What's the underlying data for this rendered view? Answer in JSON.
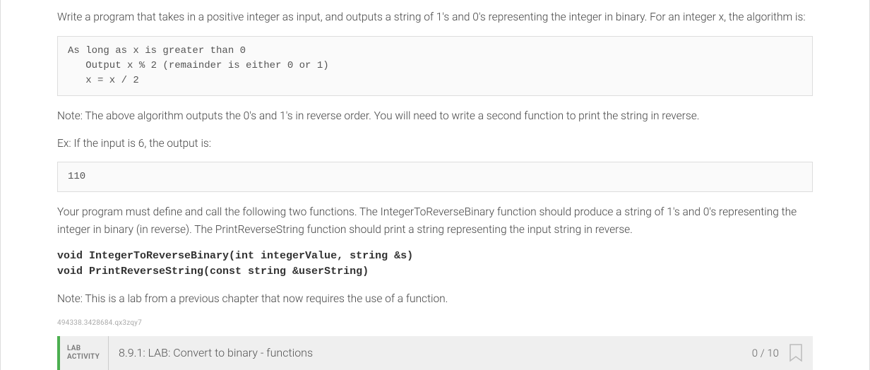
{
  "intro": "Write a program that takes in a positive integer as input, and outputs a string of 1's and 0's representing the integer in binary. For an integer x, the algorithm is:",
  "algorithm_code": "As long as x is greater than 0\n   Output x % 2 (remainder is either 0 or 1)\n   x = x / 2",
  "note_reverse": "Note: The above algorithm outputs the 0's and 1's in reverse order. You will need to write a second function to print the string in reverse.",
  "example_intro": "Ex: If the input is 6, the output is:",
  "example_output": "110",
  "functions_desc": "Your program must define and call the following two functions. The IntegerToReverseBinary function should produce a string of 1's and 0's representing the integer in binary (in reverse). The PrintReverseString function should print a string representing the input string in reverse.",
  "function_signatures": "void IntegerToReverseBinary(int integerValue, string &s)\nvoid PrintReverseString(const string &userString)",
  "lab_note": "Note: This is a lab from a previous chapter that now requires the use of a function.",
  "tracking_id": "494338.3428684.qx3zqy7",
  "lab": {
    "label_line1": "LAB",
    "label_line2": "ACTIVITY",
    "title": "8.9.1: LAB: Convert to binary - functions",
    "score": "0 / 10"
  }
}
